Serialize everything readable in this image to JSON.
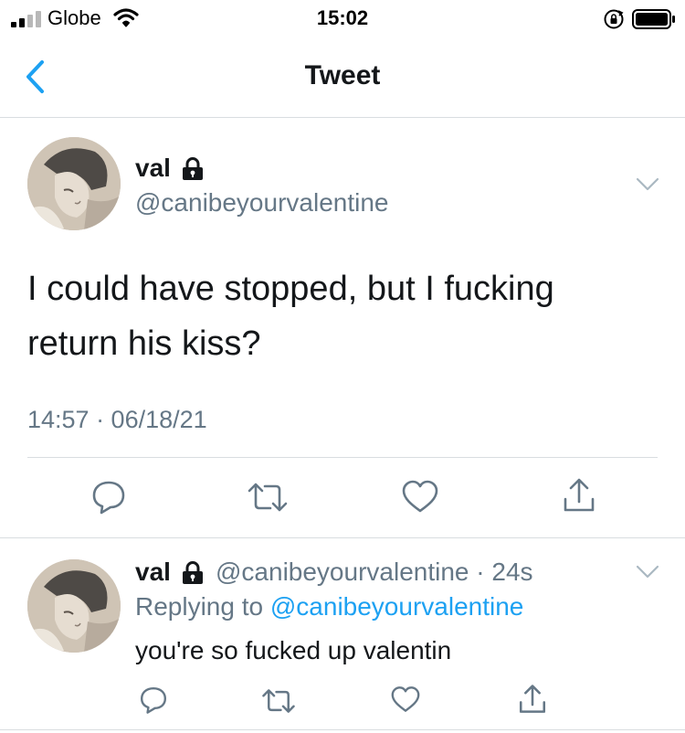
{
  "status_bar": {
    "carrier": "Globe",
    "time": "15:02",
    "icons": [
      "signal-bars-icon",
      "wifi-icon",
      "rotation-lock-icon",
      "battery-icon"
    ]
  },
  "nav": {
    "title": "Tweet",
    "back_icon": "chevron-left-icon"
  },
  "tweet": {
    "display_name": "val",
    "handle": "@canibeyourvalentine",
    "text": "I could have stopped, but I fucking return his kiss?",
    "timestamp": "14:57 · 06/18/21",
    "actions": [
      "reply-icon",
      "retweet-icon",
      "like-icon",
      "share-icon"
    ]
  },
  "reply": {
    "display_name": "val",
    "handle_time": "@canibeyourvalentine · 24s",
    "replying_prefix": "Replying to ",
    "replying_to": "@canibeyourvalentine",
    "text": "you're so fucked up valentin"
  },
  "colors": {
    "accent": "#1da1f2",
    "secondary_text": "#657786",
    "divider": "#d9dde0",
    "text": "#14171a"
  }
}
